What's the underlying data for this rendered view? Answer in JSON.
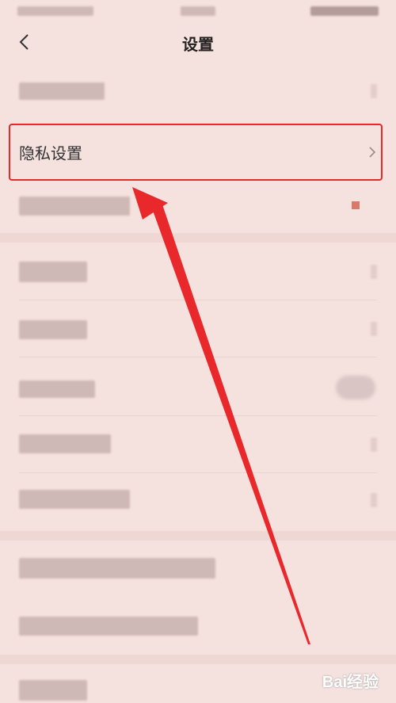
{
  "header": {
    "title": "设置"
  },
  "rows": {
    "privacy_label": "隐私设置"
  },
  "watermark": {
    "text": "Bai经验"
  },
  "colors": {
    "highlight": "#e8282b",
    "background": "#f5e1de"
  },
  "icons": {
    "back": "chevron-left-icon",
    "chevron": "chevron-right-icon"
  }
}
